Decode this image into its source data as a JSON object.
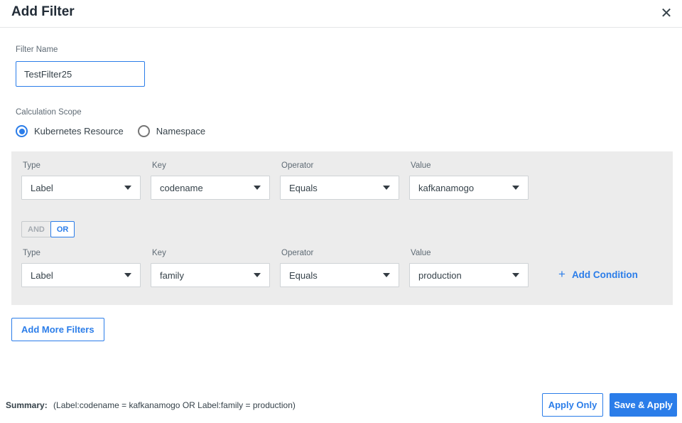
{
  "dialog": {
    "title": "Add Filter",
    "close_glyph": "✕"
  },
  "filter_name": {
    "label": "Filter Name",
    "value": "TestFilter25"
  },
  "calculation_scope": {
    "label": "Calculation Scope",
    "options": [
      {
        "label": "Kubernetes Resource",
        "selected": true
      },
      {
        "label": "Namespace",
        "selected": false
      }
    ]
  },
  "conditions": {
    "logic_toggle": {
      "and_label": "AND",
      "or_label": "OR",
      "selected": "OR"
    },
    "add_condition": {
      "plus_glyph": "+",
      "label": "Add Condition"
    },
    "rows": [
      {
        "type_label": "Type",
        "type_value": "Label",
        "key_label": "Key",
        "key_value": "codename",
        "operator_label": "Operator",
        "operator_value": "Equals",
        "value_label": "Value",
        "value_value": "kafkanamogo"
      },
      {
        "type_label": "Type",
        "type_value": "Label",
        "key_label": "Key",
        "key_value": "family",
        "operator_label": "Operator",
        "operator_value": "Equals",
        "value_label": "Value",
        "value_value": "production"
      }
    ]
  },
  "buttons": {
    "add_more_filters": "Add More Filters",
    "apply_only": "Apply Only",
    "save_and_apply": "Save & Apply"
  },
  "summary": {
    "label": "Summary:",
    "text": "(Label:codename = kafkanamogo OR Label:family = production)"
  },
  "colors": {
    "accent": "#2b7de9",
    "panel_background": "#ececec"
  }
}
